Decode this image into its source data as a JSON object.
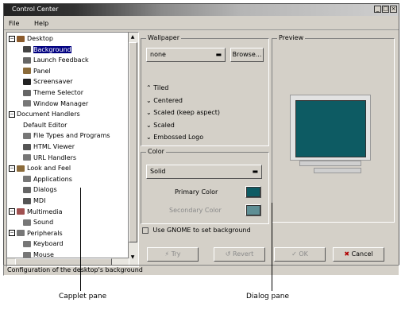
{
  "window": {
    "title": "Control Center",
    "controls": [
      "_",
      "□",
      "×"
    ]
  },
  "menu": {
    "file": "File",
    "help": "Help"
  },
  "tree": [
    {
      "label": "Desktop",
      "icon": "desktop-icon",
      "color": "#8b5a2b"
    },
    {
      "label": "Background",
      "icon": "monitor-icon",
      "color": "#444",
      "selected": true
    },
    {
      "label": "Launch Feedback",
      "icon": "hourglass-icon",
      "color": "#666"
    },
    {
      "label": "Panel",
      "icon": "panel-icon",
      "color": "#8b6b3a"
    },
    {
      "label": "Screensaver",
      "icon": "screen-icon",
      "color": "#222"
    },
    {
      "label": "Theme Selector",
      "icon": "theme-icon",
      "color": "#666"
    },
    {
      "label": "Window Manager",
      "icon": "window-icon",
      "color": "#777"
    },
    {
      "label": "Document Handlers"
    },
    {
      "label": "Default Editor"
    },
    {
      "label": "File Types and Programs",
      "icon": "filetypes-icon",
      "color": "#777"
    },
    {
      "label": "HTML Viewer",
      "icon": "html-icon",
      "color": "#555"
    },
    {
      "label": "URL Handlers",
      "icon": "url-icon",
      "color": "#777"
    },
    {
      "label": "Look and Feel",
      "icon": "look-icon",
      "color": "#8b6b3a"
    },
    {
      "label": "Applications",
      "icon": "apps-icon",
      "color": "#777"
    },
    {
      "label": "Dialogs",
      "icon": "dialogs-icon",
      "color": "#666"
    },
    {
      "label": "MDI",
      "icon": "mdi-icon",
      "color": "#555"
    },
    {
      "label": "Multimedia",
      "icon": "multimedia-icon",
      "color": "#a05050"
    },
    {
      "label": "Sound",
      "icon": "sound-icon",
      "color": "#777"
    },
    {
      "label": "Peripherals",
      "icon": "peripherals-icon",
      "color": "#777"
    },
    {
      "label": "Keyboard",
      "icon": "keyboard-icon",
      "color": "#777"
    },
    {
      "label": "Mouse",
      "icon": "mouse-icon",
      "color": "#777"
    }
  ],
  "wallpaper": {
    "group_label": "Wallpaper",
    "selected": "none",
    "browse": "Browse...",
    "options": [
      "Tiled",
      "Centered",
      "Scaled (keep aspect)",
      "Scaled",
      "Embossed Logo"
    ]
  },
  "preview": {
    "group_label": "Preview",
    "screen_color": "#0d5b63"
  },
  "color": {
    "group_label": "Color",
    "mode": "Solid",
    "primary_label": "Primary Color",
    "primary_color": "#0d5b63",
    "secondary_label": "Secondary Color",
    "secondary_color": "#5f8f95"
  },
  "use_gnome": "Use GNOME to set background",
  "buttons": {
    "try": "Try",
    "revert": "Revert",
    "ok": "OK",
    "cancel": "Cancel"
  },
  "status": "Configuration of the desktop's background",
  "callouts": {
    "capplet": "Capplet pane",
    "dialog": "Dialog pane"
  }
}
